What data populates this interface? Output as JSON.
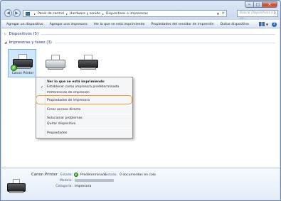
{
  "address_bar": {
    "crumbs": [
      "Panel de control",
      "Hardware y sonido",
      "Dispositivos e impresoras"
    ],
    "search_placeholder": "Buscar Dispositivos e im..."
  },
  "toolbar": {
    "items": [
      "Agregar un dispositivo",
      "Agregar una impresora",
      "Ver lo que se está imprimiendo",
      "Propiedades del servidor de impresión",
      "Quitar dispositivo"
    ]
  },
  "groups": {
    "devices": "Dispositivos (5)",
    "printers": "Impresoras y faxes (3)"
  },
  "printers": [
    {
      "label": "Canon Printer"
    },
    {
      "label": ""
    },
    {
      "label": ""
    }
  ],
  "context_menu": {
    "items": [
      "Ver lo que se está imprimiendo",
      "Establecer como impresora predeterminada",
      "Preferencias de impresión",
      "Propiedades de impresora",
      "Crear acceso directo",
      "Solucionar problemas",
      "Quitar dispositivo",
      "Propiedades"
    ]
  },
  "details": {
    "name": "Canon Printer",
    "estado_label": "Estado:",
    "estado_value": "Predeterminado",
    "estado2_label": "Estado:",
    "estado2_value": "0 documentos en cola",
    "modelo_label": "Modelo:",
    "categoria_label": "Categoría:",
    "categoria_value": "Impresora"
  },
  "colors": {
    "highlight": "#ef9a32",
    "group_heading": "#1e3287"
  }
}
